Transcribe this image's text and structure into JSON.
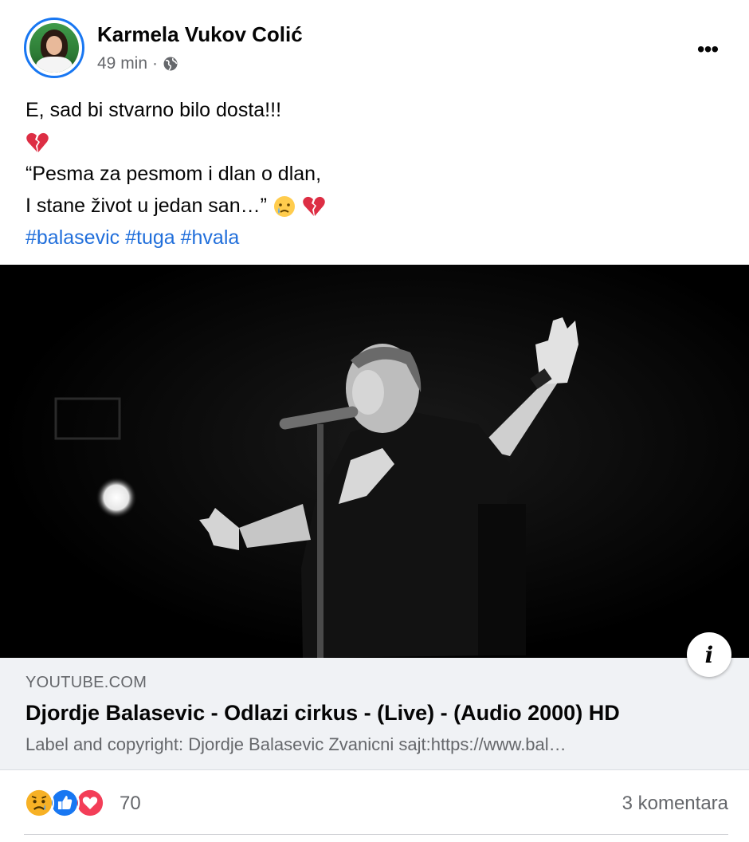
{
  "post": {
    "author": "Karmela Vukov Colić",
    "time": "49 min",
    "separator": "·",
    "privacy_icon": "globe-icon",
    "more_icon": "more-horizontal-icon",
    "more_label": "•••",
    "text_line1": "E, sad bi stvarno bilo dosta!!!",
    "quote_line1": "“Pesma za pesmom i dlan o dlan,",
    "quote_line2": "I stane život u jedan san…”",
    "hashtags": [
      "#balasevic",
      "#tuga",
      "#hvala"
    ]
  },
  "link_preview": {
    "domain": "YOUTUBE.COM",
    "title": "Djordje Balasevic - Odlazi cirkus - (Live) - (Audio 2000) HD",
    "description": "Label and copyright: Djordje Balasevic Zvanicni sajt:https://www.bal…",
    "info_label": "i"
  },
  "footer": {
    "reaction_count": "70",
    "comment_count": "3 komentara",
    "reactions": [
      "sad-react-icon",
      "like-react-icon",
      "love-react-icon"
    ]
  },
  "colors": {
    "accent": "#1877f2",
    "hashtag": "#216fdb",
    "secondary_text": "#65676b",
    "preview_bg": "#f0f2f5",
    "love": "#f33e58",
    "sad": "#f7b125"
  }
}
